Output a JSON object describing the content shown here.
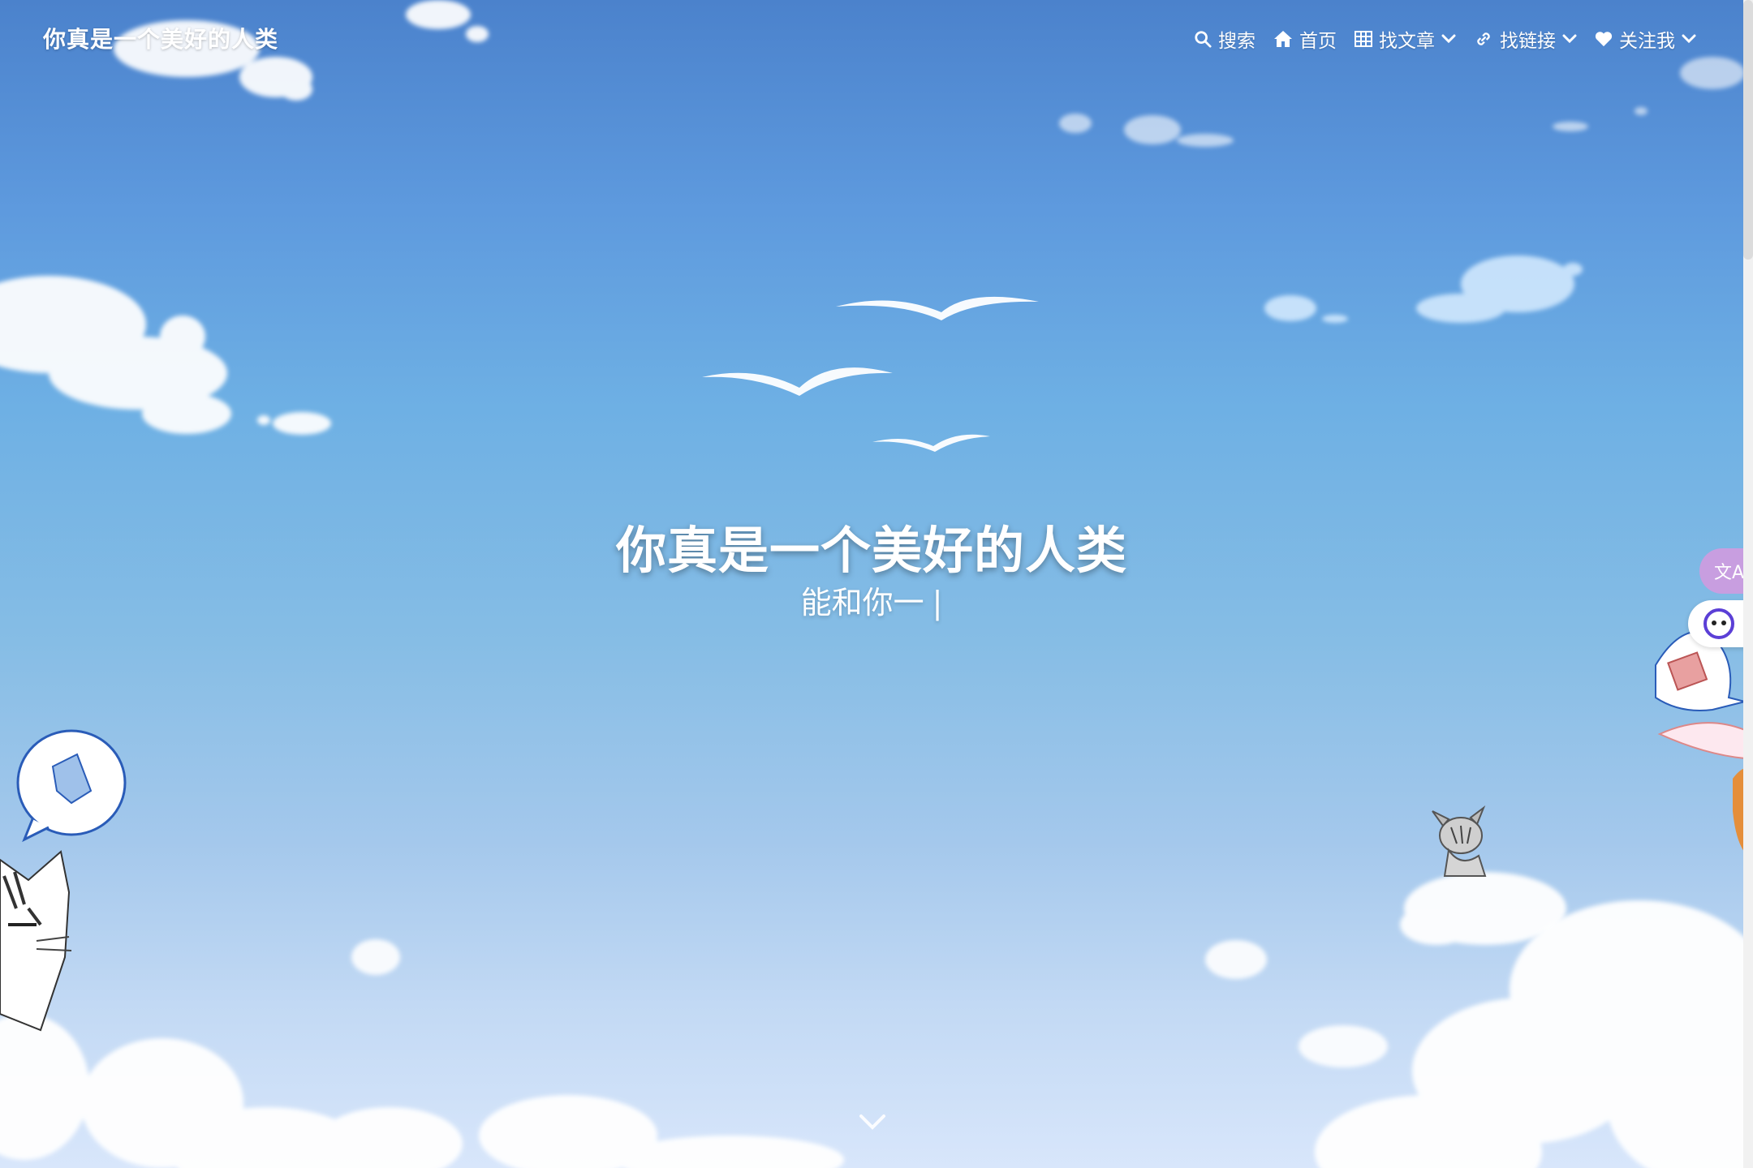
{
  "site": {
    "brand": "你真是一个美好的人类"
  },
  "nav": {
    "search": "搜索",
    "home": "首页",
    "articles": "找文章",
    "links": "找链接",
    "follow": "关注我"
  },
  "hero": {
    "title": "你真是一个美好的人类",
    "subtitle": "能和你一",
    "cursor": "|"
  },
  "widgets": {
    "translate_glyph": "文A"
  },
  "colors": {
    "sky_top": "#4b82cc",
    "sky_bottom": "#d8e6fb",
    "translate_button": "#c89ee0"
  }
}
